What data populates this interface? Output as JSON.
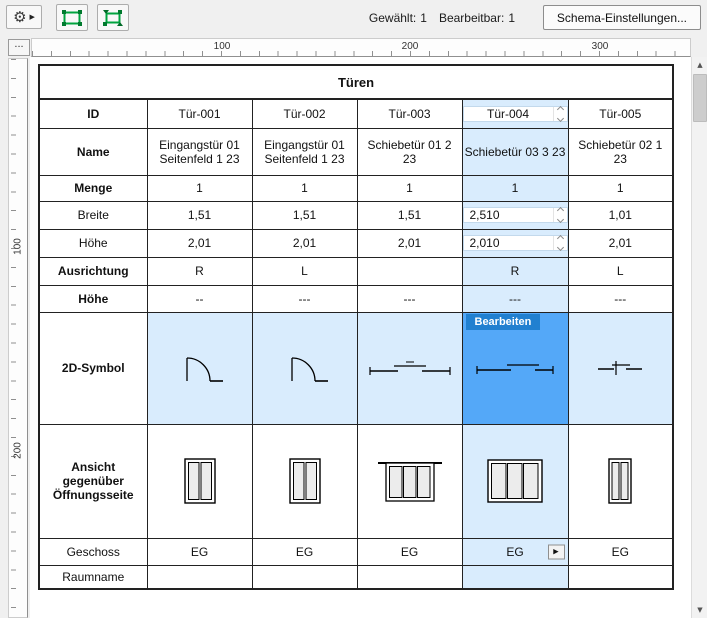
{
  "toolbar": {
    "status": {
      "gewaehlt_label": "Gewählt:",
      "gewaehlt_value": "1",
      "bearbeitbar_label": "Bearbeitbar:",
      "bearbeitbar_value": "1"
    },
    "settings_button_label": "Schema-Einstellungen..."
  },
  "icons": {
    "gear": "⚙",
    "dropdown": "▶",
    "scroll_up": "▲",
    "scroll_down": "▼",
    "jump": "▶"
  },
  "ruler": {
    "corner_label": "...",
    "horizontal_marks": [
      "100",
      "200",
      "300"
    ],
    "vertical_marks": [
      "100",
      "200"
    ]
  },
  "schedule": {
    "title": "Türen",
    "edit_button_label": "Bearbeiten",
    "rows": {
      "id": {
        "label": "ID",
        "values": [
          "Tür-001",
          "Tür-002",
          "Tür-003",
          "Tür-004",
          "Tür-005"
        ]
      },
      "name": {
        "label": "Name",
        "values": [
          "Eingangstür 01 Seitenfeld 1 23",
          "Eingangstür 01 Seitenfeld 1 23",
          "Schiebetür 01 2 23",
          "Schiebetür 03 3 23",
          "Schiebetür 02 1 23"
        ]
      },
      "menge": {
        "label": "Menge",
        "values": [
          "1",
          "1",
          "1",
          "1",
          "1"
        ]
      },
      "breite": {
        "label": "Breite",
        "values": [
          "1,51",
          "1,51",
          "1,51",
          "2,510",
          "1,01"
        ]
      },
      "hoehe": {
        "label": "Höhe",
        "values": [
          "2,01",
          "2,01",
          "2,01",
          "2,010",
          "2,01"
        ]
      },
      "ausrichtung": {
        "label": "Ausrichtung",
        "values": [
          "R",
          "L",
          "",
          "R",
          "L"
        ]
      },
      "hoehe2": {
        "label": "Höhe",
        "values": [
          "--",
          "---",
          "---",
          "---",
          "---"
        ]
      },
      "symbol2d": {
        "label": "2D-Symbol"
      },
      "ansicht": {
        "label": "Ansicht gegenüber Öffnungsseite"
      },
      "geschoss": {
        "label": "Geschoss",
        "values": [
          "EG",
          "EG",
          "EG",
          "EG",
          "EG"
        ]
      },
      "raumname": {
        "label": "Raumname",
        "values": [
          "",
          "",
          "",
          "",
          ""
        ]
      }
    }
  },
  "colors": {
    "selection_light": "#d9ecfd",
    "selection_strong": "#54a8f8",
    "edit_badge": "#2180d0",
    "icon_green": "#00a33e"
  }
}
